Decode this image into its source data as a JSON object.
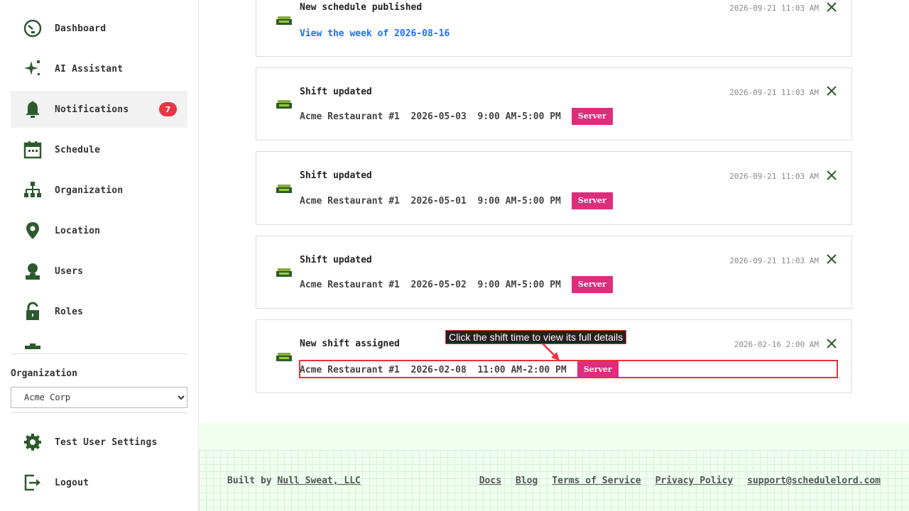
{
  "sidebar": {
    "items": [
      {
        "label": "Dashboard",
        "icon": "dashboard-icon"
      },
      {
        "label": "AI Assistant",
        "icon": "sparkle-icon"
      },
      {
        "label": "Notifications",
        "icon": "bell-icon",
        "badge": "7",
        "active": true
      },
      {
        "label": "Schedule",
        "icon": "calendar-icon"
      },
      {
        "label": "Organization",
        "icon": "org-chart-icon"
      },
      {
        "label": "Location",
        "icon": "location-pin-icon"
      },
      {
        "label": "Users",
        "icon": "user-icon"
      },
      {
        "label": "Roles",
        "icon": "lock-icon"
      }
    ],
    "org_label": "Organization",
    "org_selected": "Acme Corp",
    "bottom_items": [
      {
        "label": "Test User Settings",
        "icon": "gear-icon"
      },
      {
        "label": "Logout",
        "icon": "logout-icon"
      }
    ]
  },
  "notifications": [
    {
      "title": "New schedule published",
      "time": "2026-09-21 11:03 AM",
      "link": "View the week of 2026-08-16"
    },
    {
      "title": "Shift updated",
      "time": "2026-09-21 11:03 AM",
      "location": "Acme Restaurant #1",
      "date": "2026-05-03",
      "hours": "9:00 AM-5:00 PM",
      "role": "Server"
    },
    {
      "title": "Shift updated",
      "time": "2026-09-21 11:03 AM",
      "location": "Acme Restaurant #1",
      "date": "2026-05-01",
      "hours": "9:00 AM-5:00 PM",
      "role": "Server"
    },
    {
      "title": "Shift updated",
      "time": "2026-09-21 11:03 AM",
      "location": "Acme Restaurant #1",
      "date": "2026-05-02",
      "hours": "9:00 AM-5:00 PM",
      "role": "Server"
    },
    {
      "title": "New shift assigned",
      "time": "2026-02-16 2:00 AM",
      "location": "Acme Restaurant #1",
      "date": "2026-02-08",
      "hours": "11:00 AM-2:00 PM",
      "role": "Server"
    }
  ],
  "callout": "Click the shift time to view its full details",
  "footer": {
    "built_by_prefix": "Built by",
    "built_by_link": "Null Sweat, LLC",
    "links": [
      "Docs",
      "Blog",
      "Terms of Service",
      "Privacy Policy",
      "support@schedulelord.com"
    ]
  },
  "colors": {
    "accent": "#2d5a2d",
    "tag": "#dd2d7b",
    "badge": "#ee3344",
    "link": "#1a6fff"
  }
}
